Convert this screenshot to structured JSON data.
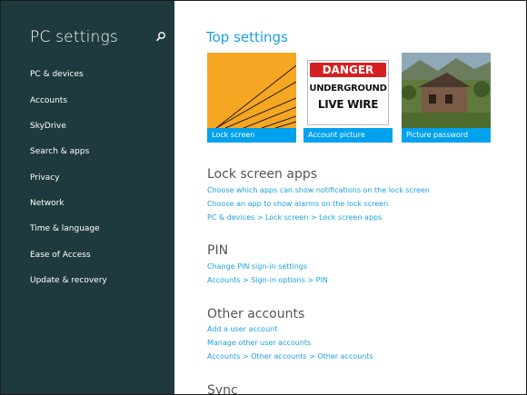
{
  "sidebar": {
    "title": "PC settings",
    "items": [
      {
        "label": "PC & devices"
      },
      {
        "label": "Accounts"
      },
      {
        "label": "SkyDrive"
      },
      {
        "label": "Search & apps"
      },
      {
        "label": "Privacy"
      },
      {
        "label": "Network"
      },
      {
        "label": "Time & language"
      },
      {
        "label": "Ease of Access"
      },
      {
        "label": "Update & recovery"
      }
    ]
  },
  "main": {
    "top_title": "Top settings",
    "tiles": [
      {
        "caption": "Lock screen"
      },
      {
        "caption": "Account picture",
        "sign_heading": "DANGER",
        "sign_line1": "UNDERGROUND",
        "sign_line2": "LIVE WIRE"
      },
      {
        "caption": "Picture password"
      }
    ],
    "sections": [
      {
        "title": "Lock screen apps",
        "links": [
          "Choose which apps can show notifications on the lock screen",
          "Choose an app to show alarms on the lock screen",
          "PC & devices > Lock screen > Lock screen apps"
        ]
      },
      {
        "title": "PIN",
        "links": [
          "Change PIN sign-in settings",
          "Accounts > Sign-in options > PIN"
        ]
      },
      {
        "title": "Other accounts",
        "links": [
          "Add a user account",
          "Manage other user accounts",
          "Accounts > Other accounts > Other accounts"
        ]
      },
      {
        "title": "Sync",
        "links": []
      }
    ]
  },
  "colors": {
    "sidebar_bg": "#1f3a3e",
    "accent": "#1ba1e2",
    "tile_caption": "#00a2ed"
  }
}
